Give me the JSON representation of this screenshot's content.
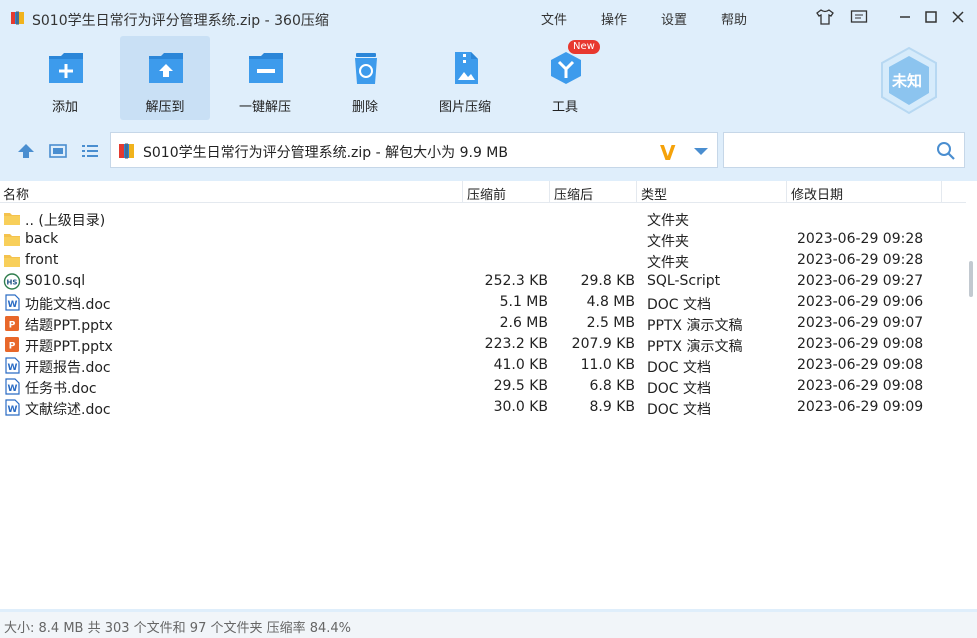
{
  "window": {
    "title": "S010学生日常行为评分管理系统.zip - 360压缩",
    "menu": [
      "文件",
      "操作",
      "设置",
      "帮助"
    ]
  },
  "toolbar": {
    "items": [
      {
        "label": "添加",
        "icon": "add-icon"
      },
      {
        "label": "解压到",
        "icon": "extract-to-icon",
        "active": true
      },
      {
        "label": "一键解压",
        "icon": "one-click-extract-icon"
      },
      {
        "label": "删除",
        "icon": "delete-icon"
      },
      {
        "label": "图片压缩",
        "icon": "image-compress-icon"
      },
      {
        "label": "工具",
        "icon": "tools-icon"
      }
    ],
    "new_badge": "New",
    "unknown_badge": "未知"
  },
  "address": {
    "path": "S010学生日常行为评分管理系统.zip - 解包大小为 9.9 MB",
    "search_placeholder": ""
  },
  "columns": {
    "name": "名称",
    "size": "压缩前",
    "compressed": "压缩后",
    "type": "类型",
    "modified": "修改日期"
  },
  "files": [
    {
      "name": ".. (上级目录)",
      "size": "",
      "compressed": "",
      "type": "文件夹",
      "modified": "",
      "icon": "folder-icon"
    },
    {
      "name": "back",
      "size": "",
      "compressed": "",
      "type": "文件夹",
      "modified": "2023-06-29 09:28",
      "icon": "folder-icon"
    },
    {
      "name": "front",
      "size": "",
      "compressed": "",
      "type": "文件夹",
      "modified": "2023-06-29 09:28",
      "icon": "folder-icon"
    },
    {
      "name": "S010.sql",
      "size": "252.3 KB",
      "compressed": "29.8 KB",
      "type": "SQL-Script",
      "modified": "2023-06-29 09:27",
      "icon": "sql-file-icon"
    },
    {
      "name": "功能文档.doc",
      "size": "5.1 MB",
      "compressed": "4.8 MB",
      "type": "DOC 文档",
      "modified": "2023-06-29 09:06",
      "icon": "word-doc-icon"
    },
    {
      "name": "结题PPT.pptx",
      "size": "2.6 MB",
      "compressed": "2.5 MB",
      "type": "PPTX 演示文稿",
      "modified": "2023-06-29 09:07",
      "icon": "pptx-file-icon"
    },
    {
      "name": "开题PPT.pptx",
      "size": "223.2 KB",
      "compressed": "207.9 KB",
      "type": "PPTX 演示文稿",
      "modified": "2023-06-29 09:08",
      "icon": "pptx-file-icon"
    },
    {
      "name": "开题报告.doc",
      "size": "41.0 KB",
      "compressed": "11.0 KB",
      "type": "DOC 文档",
      "modified": "2023-06-29 09:08",
      "icon": "word-doc-icon"
    },
    {
      "name": "任务书.doc",
      "size": "29.5 KB",
      "compressed": "6.8 KB",
      "type": "DOC 文档",
      "modified": "2023-06-29 09:08",
      "icon": "word-doc-icon"
    },
    {
      "name": "文献综述.doc",
      "size": "30.0 KB",
      "compressed": "8.9 KB",
      "type": "DOC 文档",
      "modified": "2023-06-29 09:09",
      "icon": "word-doc-icon"
    }
  ],
  "status": "大小: 8.4 MB 共 303 个文件和 97 个文件夹 压缩率 84.4%",
  "colors": {
    "background": "#dfeefb",
    "accent": "#2b86d8",
    "active_tool": "#c9e0f5"
  }
}
